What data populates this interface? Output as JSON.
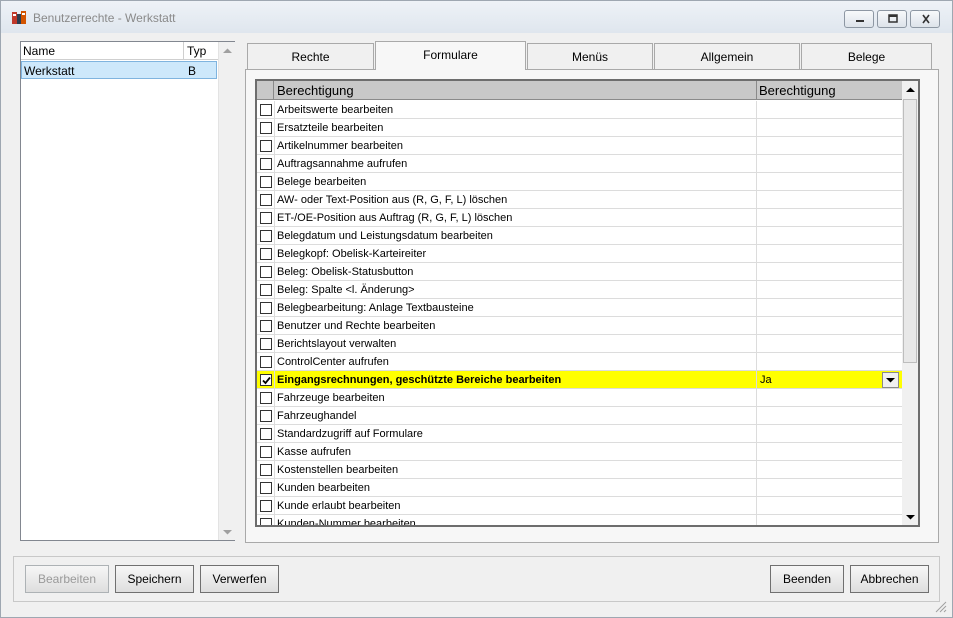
{
  "window": {
    "title": "Benutzerrechte - Werkstatt"
  },
  "userlist": {
    "columns": [
      "Name",
      "Typ"
    ],
    "rows": [
      {
        "name": "Werkstatt",
        "typ": "B"
      }
    ]
  },
  "tabs": [
    "Rechte",
    "Formulare",
    "Menüs",
    "Allgemein",
    "Belege"
  ],
  "active_tab": "Formulare",
  "grid": {
    "columns": [
      "Berechtigung",
      "Berechtigung"
    ],
    "rows": [
      {
        "label": "Arbeitswerte bearbeiten",
        "checked": false,
        "value": ""
      },
      {
        "label": "Ersatzteile bearbeiten",
        "checked": false,
        "value": ""
      },
      {
        "label": "Artikelnummer bearbeiten",
        "checked": false,
        "value": ""
      },
      {
        "label": "Auftragsannahme aufrufen",
        "checked": false,
        "value": ""
      },
      {
        "label": "Belege bearbeiten",
        "checked": false,
        "value": ""
      },
      {
        "label": "AW- oder Text-Position aus (R, G, F, L) löschen",
        "checked": false,
        "value": ""
      },
      {
        "label": "ET-/OE-Position aus Auftrag (R, G, F, L) löschen",
        "checked": false,
        "value": ""
      },
      {
        "label": "Belegdatum und Leistungsdatum bearbeiten",
        "checked": false,
        "value": ""
      },
      {
        "label": "Belegkopf: Obelisk-Karteireiter",
        "checked": false,
        "value": ""
      },
      {
        "label": "Beleg: Obelisk-Statusbutton",
        "checked": false,
        "value": ""
      },
      {
        "label": "Beleg: Spalte <l. Änderung>",
        "checked": false,
        "value": ""
      },
      {
        "label": "Belegbearbeitung: Anlage Textbausteine",
        "checked": false,
        "value": ""
      },
      {
        "label": "Benutzer und Rechte bearbeiten",
        "checked": false,
        "value": ""
      },
      {
        "label": "Berichtslayout verwalten",
        "checked": false,
        "value": ""
      },
      {
        "label": "ControlCenter aufrufen",
        "checked": false,
        "value": ""
      },
      {
        "label": "Eingangsrechnungen, geschützte Bereiche bearbeiten",
        "checked": true,
        "value": "Ja",
        "selected": true
      },
      {
        "label": "Fahrzeuge bearbeiten",
        "checked": false,
        "value": ""
      },
      {
        "label": "Fahrzeughandel",
        "checked": false,
        "value": ""
      },
      {
        "label": "Standardzugriff auf Formulare",
        "checked": false,
        "value": ""
      },
      {
        "label": "Kasse aufrufen",
        "checked": false,
        "value": ""
      },
      {
        "label": "Kostenstellen bearbeiten",
        "checked": false,
        "value": ""
      },
      {
        "label": "Kunden bearbeiten",
        "checked": false,
        "value": ""
      },
      {
        "label": "Kunde erlaubt bearbeiten",
        "checked": false,
        "value": ""
      },
      {
        "label": "Kunden-Nummer bearbeiten",
        "checked": false,
        "value": ""
      }
    ]
  },
  "buttons": {
    "bearbeiten": "Bearbeiten",
    "speichern": "Speichern",
    "verwerfen": "Verwerfen",
    "beenden": "Beenden",
    "abbrechen": "Abbrechen"
  },
  "colors": {
    "selected_row": "#ffff00",
    "list_selection": "#cde8fb",
    "grid_header": "#c8c8c8"
  }
}
